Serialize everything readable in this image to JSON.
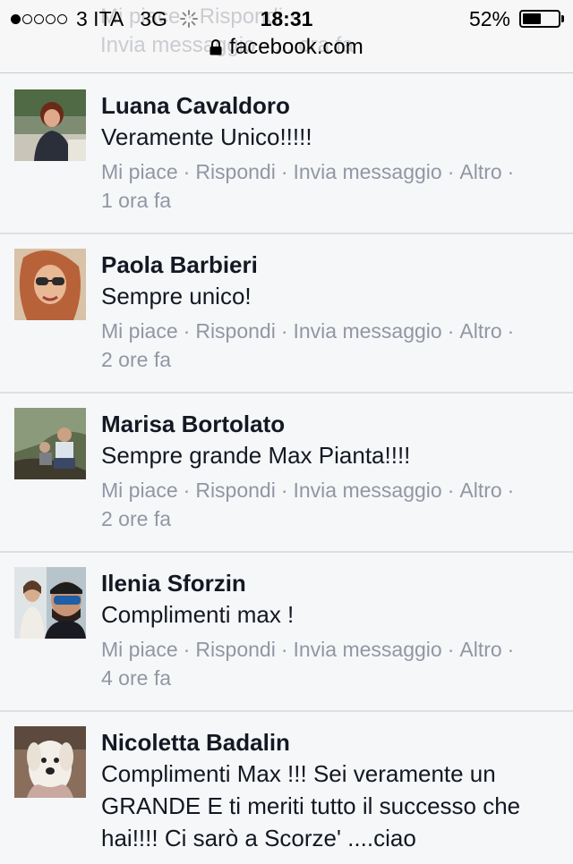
{
  "status_bar": {
    "carrier": "3 ITA",
    "network": "3G",
    "time": "18:31",
    "battery_percent": "52%",
    "battery_level": 0.52,
    "signal_bars_filled": 1,
    "signal_bars_total": 5
  },
  "browser": {
    "url": "facebook.com"
  },
  "ghost_above": {
    "line1": "Mi piace · Rispondi ·",
    "line2": "Invia messaggio · ... ora fa"
  },
  "comments": [
    {
      "name": "Luana Cavaldoro",
      "text": "Veramente Unico!!!!!",
      "like": "Mi piace",
      "reply": "Rispondi",
      "message": "Invia messaggio",
      "more": "Altro",
      "time": "1 ora fa"
    },
    {
      "name": "Paola Barbieri",
      "text": "Sempre unico!",
      "like": "Mi piace",
      "reply": "Rispondi",
      "message": "Invia messaggio",
      "more": "Altro",
      "time": "2 ore fa"
    },
    {
      "name": "Marisa Bortolato",
      "text": "Sempre grande Max Pianta!!!!",
      "like": "Mi piace",
      "reply": "Rispondi",
      "message": "Invia messaggio",
      "more": "Altro",
      "time": "2 ore fa"
    },
    {
      "name": "Ilenia Sforzin",
      "text": "Complimenti max !",
      "like": "Mi piace",
      "reply": "Rispondi",
      "message": "Invia messaggio",
      "more": "Altro",
      "time": "4 ore fa"
    },
    {
      "name": "Nicoletta Badalin",
      "text": "Complimenti Max !!! Sei veramente un GRANDE E ti meriti tutto il successo che hai!!!! Ci sarò a Scorze' ....ciao"
    }
  ],
  "colors": {
    "background": "#f6f7f9",
    "name_text": "#141823",
    "action_text": "#9197a3",
    "divider": "#dddfe2"
  }
}
